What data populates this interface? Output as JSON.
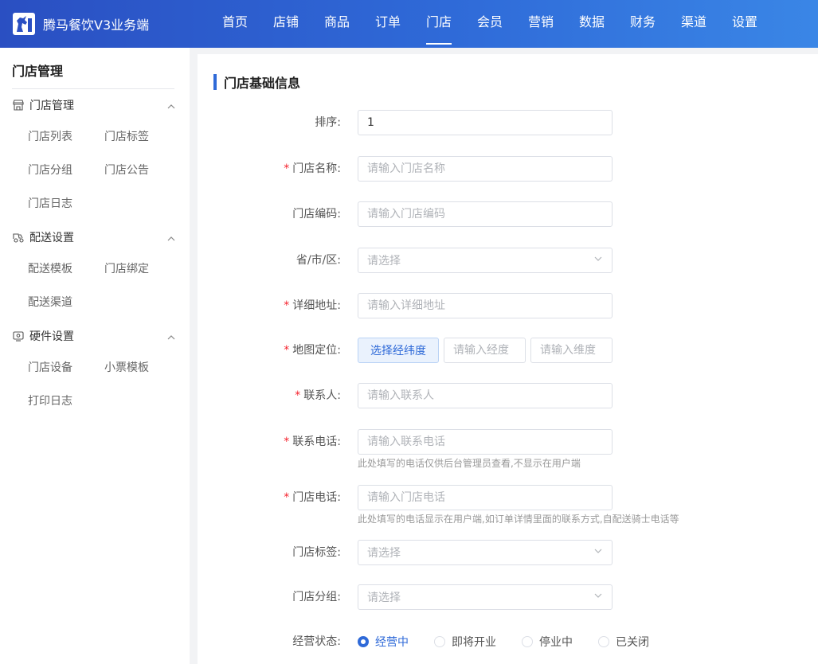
{
  "brand": {
    "name": "腾马餐饮V3业务端"
  },
  "nav": [
    {
      "label": "首页"
    },
    {
      "label": "店铺"
    },
    {
      "label": "商品"
    },
    {
      "label": "订单"
    },
    {
      "label": "门店",
      "active": true
    },
    {
      "label": "会员"
    },
    {
      "label": "营销"
    },
    {
      "label": "数据"
    },
    {
      "label": "财务"
    },
    {
      "label": "渠道"
    },
    {
      "label": "设置"
    }
  ],
  "sidebar": {
    "title": "门店管理",
    "groups": [
      {
        "label": "门店管理",
        "icon": "store-icon",
        "items": [
          "门店列表",
          "门店标签",
          "门店分组",
          "门店公告",
          "门店日志"
        ]
      },
      {
        "label": "配送设置",
        "icon": "delivery-icon",
        "items": [
          "配送模板",
          "门店绑定",
          "配送渠道"
        ]
      },
      {
        "label": "硬件设置",
        "icon": "device-icon",
        "items": [
          "门店设备",
          "小票模板",
          "打印日志"
        ]
      }
    ]
  },
  "form": {
    "section_title": "门店基础信息",
    "sort": {
      "label": "排序:",
      "value": "1"
    },
    "name": {
      "label": "门店名称:",
      "placeholder": "请输入门店名称"
    },
    "code": {
      "label": "门店编码:",
      "placeholder": "请输入门店编码"
    },
    "region": {
      "label": "省/市/区:",
      "placeholder": "请选择"
    },
    "address": {
      "label": "详细地址:",
      "placeholder": "请输入详细地址"
    },
    "location": {
      "label": "地图定位:",
      "button": "选择经纬度",
      "lng_placeholder": "请输入经度",
      "lat_placeholder": "请输入维度"
    },
    "contact": {
      "label": "联系人:",
      "placeholder": "请输入联系人"
    },
    "contact_phone": {
      "label": "联系电话:",
      "placeholder": "请输入联系电话",
      "hint": "此处填写的电话仅供后台管理员查看,不显示在用户端"
    },
    "store_phone": {
      "label": "门店电话:",
      "placeholder": "请输入门店电话",
      "hint": "此处填写的电话显示在用户端,如订单详情里面的联系方式,自配送骑士电话等"
    },
    "tags": {
      "label": "门店标签:",
      "placeholder": "请选择"
    },
    "group": {
      "label": "门店分组:",
      "placeholder": "请选择"
    },
    "status": {
      "label": "经营状态:",
      "options": [
        "经营中",
        "即将开业",
        "停业中",
        "已关闭"
      ],
      "selected": "经营中"
    }
  },
  "colors": {
    "primary": "#2f6ad8",
    "required": "#f5222d"
  }
}
